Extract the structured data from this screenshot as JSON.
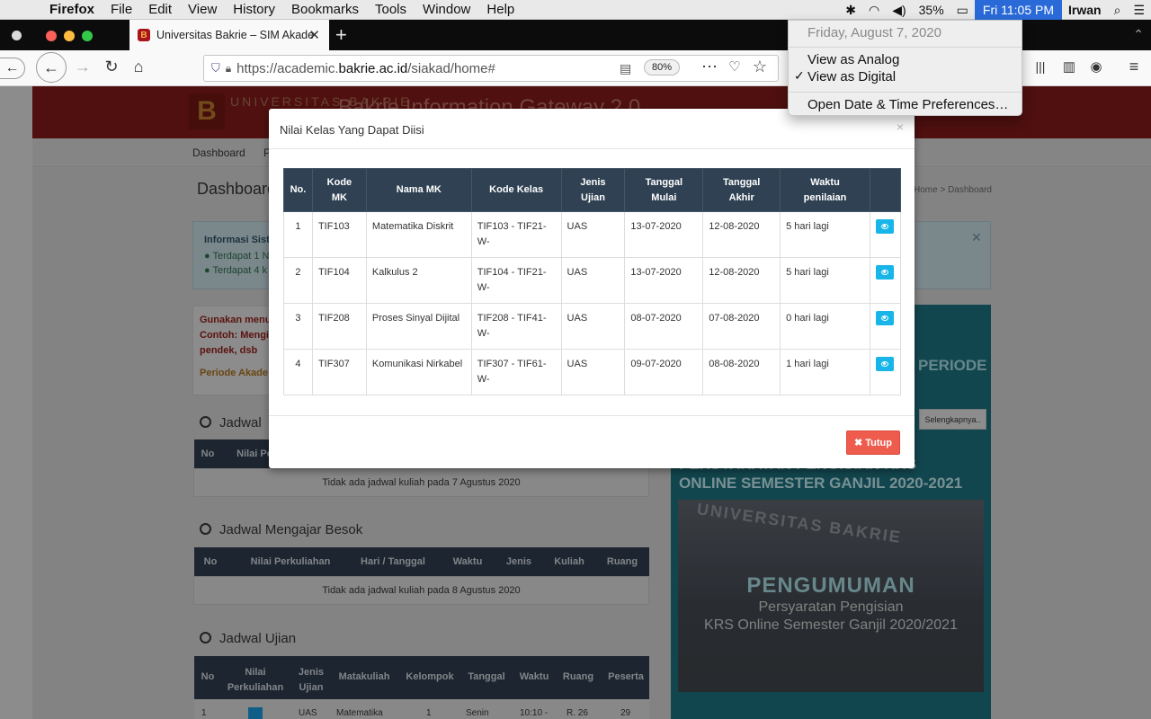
{
  "menubar": {
    "app": "Firefox",
    "menus": [
      "File",
      "Edit",
      "View",
      "History",
      "Bookmarks",
      "Tools",
      "Window",
      "Help"
    ],
    "battery": "35%",
    "clock": "Fri 11:05 PM",
    "user": "Irwan"
  },
  "browser": {
    "tab_title": "Universitas Bakrie – SIM Akade",
    "url_prefix": "https://academic.",
    "url_domain": "bakrie.ac.id",
    "url_path": "/siakad/home#",
    "zoom": "80%"
  },
  "site": {
    "logo_letter": "B",
    "name": "UNIVERSITAS BAKRIE",
    "gateway": "Bakrie Information Gateway 2.0",
    "nav": [
      "Dashboard",
      "P"
    ],
    "page_title": "Dashboard",
    "breadcrumb": "Home > Dashboard",
    "info_title": "Informasi Sist",
    "info_items": [
      "Terdapat 1 N",
      "Terdapat 4 k"
    ],
    "warn_lines": [
      "Gunakan menu",
      "Contoh: Mengi",
      "pendek, dsb"
    ],
    "warn_periode": "Periode Akade",
    "jadwal_today_title": "Jadwal",
    "jadwal_today_heads": [
      "No",
      "Nilai Pe"
    ],
    "jadwal_today_empty": "Tidak ada jadwal kuliah pada 7 Agustus 2020",
    "jadwal_besok_title": "Jadwal Mengajar Besok",
    "jadwal_besok_heads": [
      "No",
      "Nilai Perkuliahan",
      "Hari / Tanggal",
      "Waktu",
      "Jenis",
      "Kuliah",
      "Ruang"
    ],
    "jadwal_besok_empty": "Tidak ada jadwal kuliah pada 8 Agustus 2020",
    "ujian_title": "Jadwal Ujian",
    "ujian_heads": [
      "No",
      "Nilai Perkuliahan",
      "Jenis Ujian",
      "Matakuliah",
      "Kelompok",
      "Tanggal",
      "Waktu",
      "Ruang",
      "Peserta"
    ],
    "ujian_partial_row": [
      "1",
      "",
      "UAS",
      "Matematika",
      "1",
      "Senin",
      "10:10 -",
      "R. 26",
      "29"
    ],
    "right_periode": "PERIODE",
    "right_more": "Selengkapnya..",
    "right_krs_1": "PERSYARATAN PENGISIAN KRS",
    "right_krs_2": "ONLINE SEMESTER GANJIL 2020-2021",
    "right_pengumuman": "PENGUMUMAN",
    "right_sub_1": "Persyaratan Pengisian",
    "right_sub_2": "KRS Online Semester Ganjil 2020/2021",
    "right_img_text": "UNIVERSITAS BAKRIE"
  },
  "modal": {
    "title": "Nilai Kelas Yang Dapat Diisi",
    "close_label": "Tutup",
    "headers": [
      "No.",
      "Kode MK",
      "Nama MK",
      "Kode Kelas",
      "Jenis Ujian",
      "Tanggal Mulai",
      "Tanggal Akhir",
      "Waktu penilaian",
      ""
    ],
    "rows": [
      {
        "no": "1",
        "kode": "TIF103",
        "nama": "Matematika Diskrit",
        "kelas": "TIF103 - TIF21-W-",
        "jenis": "UAS",
        "mulai": "13-07-2020",
        "akhir": "12-08-2020",
        "waktu": "5 hari lagi"
      },
      {
        "no": "2",
        "kode": "TIF104",
        "nama": "Kalkulus 2",
        "kelas": "TIF104 - TIF21-W-",
        "jenis": "UAS",
        "mulai": "13-07-2020",
        "akhir": "12-08-2020",
        "waktu": "5 hari lagi"
      },
      {
        "no": "3",
        "kode": "TIF208",
        "nama": "Proses Sinyal Dijital",
        "kelas": "TIF208 - TIF41-W-",
        "jenis": "UAS",
        "mulai": "08-07-2020",
        "akhir": "07-08-2020",
        "waktu": "0 hari lagi"
      },
      {
        "no": "4",
        "kode": "TIF307",
        "nama": "Komunikasi Nirkabel",
        "kelas": "TIF307 - TIF61-W-",
        "jenis": "UAS",
        "mulai": "09-07-2020",
        "akhir": "08-08-2020",
        "waktu": "1 hari lagi"
      }
    ]
  },
  "date_menu": {
    "date": "Friday, August 7, 2020",
    "analog": "View as Analog",
    "digital": "View as Digital",
    "prefs": "Open Date & Time Preferences…"
  },
  "colors": {
    "modal_header_bg": "#2f4152",
    "eye_button": "#17b5e8",
    "close_button": "#ee5c4e",
    "clock_highlight": "#2a6ad8"
  }
}
